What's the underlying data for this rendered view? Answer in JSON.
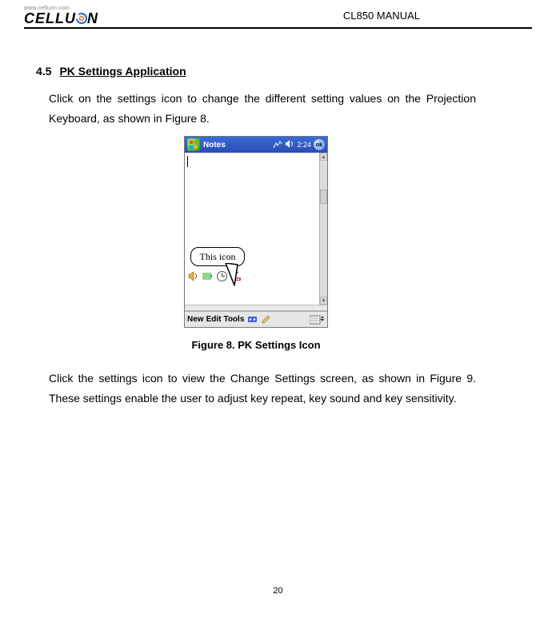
{
  "header": {
    "logo_url": "www.celluon.com",
    "logo_text_left": "CELLU",
    "logo_text_right": "N",
    "title": "CL850 MANUAL"
  },
  "section": {
    "number": "4.5",
    "title": "PK Settings Application"
  },
  "paragraph1": "Click on the settings icon to change the different setting values on the Projection Keyboard, as shown in Figure 8.",
  "figure": {
    "callout": "This icon",
    "caption": "Figure 8. PK Settings Icon"
  },
  "pda": {
    "app_title": "Notes",
    "clock": "2:24",
    "ok": "ok",
    "menu": {
      "new": "New",
      "edit": "Edit",
      "tools": "Tools"
    }
  },
  "paragraph2": "Click the settings icon to view the Change Settings screen, as shown in Figure 9. These settings enable the user to adjust key repeat, key sound and key sensitivity.",
  "page_number": "20"
}
